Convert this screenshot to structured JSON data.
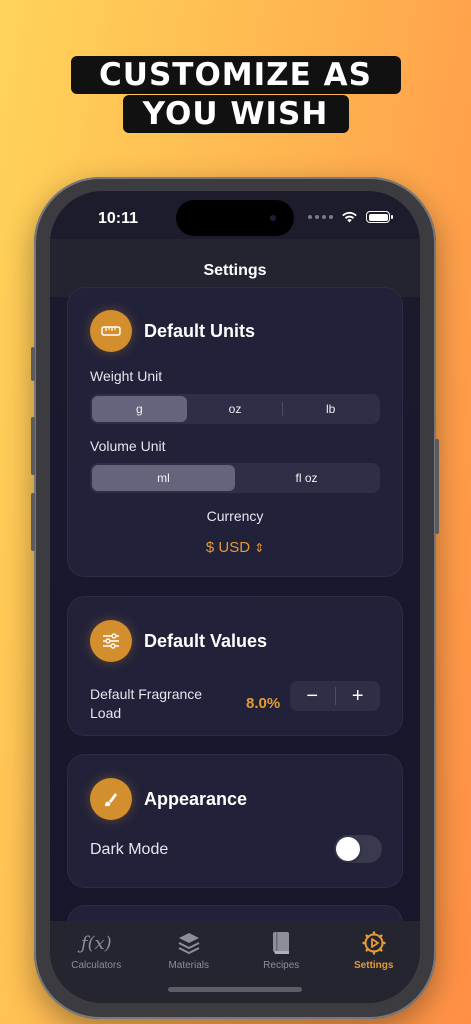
{
  "headline": {
    "line1": "CUSTOMIZE AS",
    "line2": "YOU WISH"
  },
  "status": {
    "time": "10:11"
  },
  "nav": {
    "title": "Settings"
  },
  "default_units": {
    "title": "Default Units",
    "icon": "ruler-icon",
    "weight_label": "Weight Unit",
    "weight_options": [
      "g",
      "oz",
      "lb"
    ],
    "weight_selected": "g",
    "volume_label": "Volume Unit",
    "volume_options": [
      "ml",
      "fl oz"
    ],
    "volume_selected": "ml",
    "currency_label": "Currency",
    "currency_value": "$ USD",
    "currency_chevron": "⌃⌄"
  },
  "default_values": {
    "title": "Default Values",
    "icon": "sliders-icon",
    "load_label": "Default Fragrance Load",
    "load_value": "8.0%",
    "minus": "−",
    "plus": "+"
  },
  "appearance": {
    "title": "Appearance",
    "icon": "paintbrush-icon",
    "dark_mode_label": "Dark Mode",
    "dark_mode_on": false
  },
  "tabs": [
    {
      "label": "Calculators",
      "icon": "function-icon",
      "active": false
    },
    {
      "label": "Materials",
      "icon": "layers-icon",
      "active": false
    },
    {
      "label": "Recipes",
      "icon": "book-icon",
      "active": false
    },
    {
      "label": "Settings",
      "icon": "gear-icon",
      "active": true
    }
  ],
  "colors": {
    "accent": "#e39b33",
    "card": "#21213a",
    "background": "#18182e"
  }
}
